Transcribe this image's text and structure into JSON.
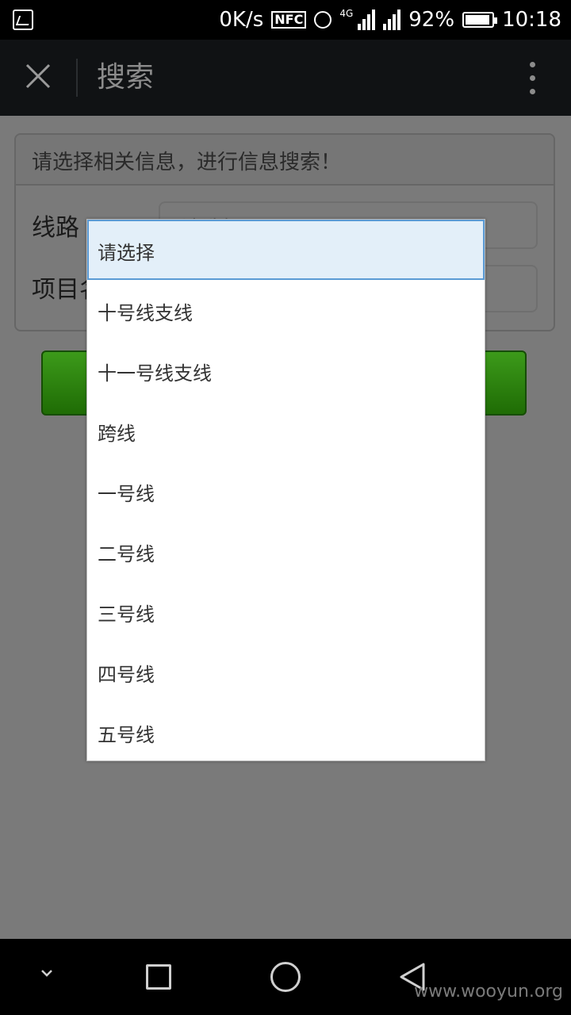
{
  "status_bar": {
    "net_speed": "0K/s",
    "nfc": "NFC",
    "network_type": "4G",
    "battery": "92%",
    "time": "10:18"
  },
  "header": {
    "title": "搜索"
  },
  "form": {
    "notice": "请选择相关信息，进行信息搜索！",
    "line_label": "线路",
    "project_label": "项目名",
    "placeholder": "请选择"
  },
  "dropdown": {
    "selected": "请选择",
    "options": [
      "请选择",
      "十号线支线",
      "十一号线支线",
      "跨线",
      "一号线",
      "二号线",
      "三号线",
      "四号线",
      "五号线"
    ]
  },
  "watermark": "www.wooyun.org"
}
